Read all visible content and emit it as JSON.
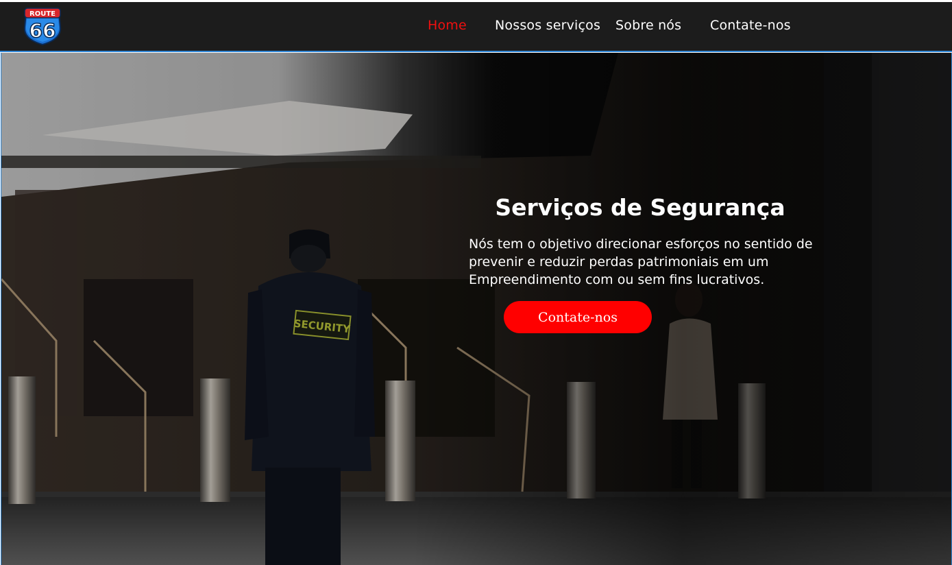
{
  "logo": {
    "top_text": "ROUTE",
    "number": "66"
  },
  "nav": {
    "home": "Home",
    "services": "Nossos serviços",
    "about": "Sobre nós",
    "contact": "Contate-nos"
  },
  "hero": {
    "title": "Serviços de Segurança",
    "text": "Nós tem o objetivo direcionar esforços no sentido de prevenir e reduzir perdas patrimoniais em um Empreendimento com ou sem fins lucrativos.",
    "cta_label": "Contate-nos",
    "badge_text": "SECURITY"
  },
  "colors": {
    "nav_bg": "#1c1c1c",
    "active_link": "#f01010",
    "accent_border": "#2f86d6",
    "cta_bg": "#ff0000",
    "text": "#ffffff"
  }
}
